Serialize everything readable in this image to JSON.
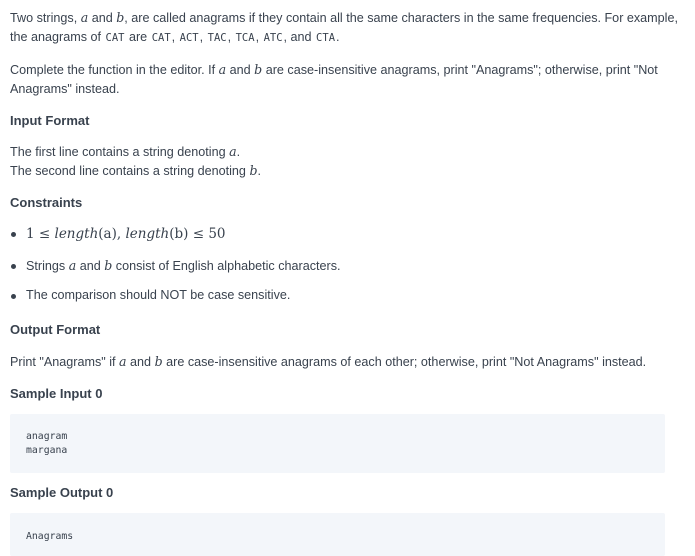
{
  "intro": {
    "t1": "Two strings, ",
    "a": "a",
    "t2": " and ",
    "b": "b",
    "t3": ", are called anagrams if they contain all the same characters in the same frequencies. For example, the anagrams of ",
    "code1": "CAT",
    "t4": " are ",
    "code2": "CAT",
    "sep1": ", ",
    "code3": "ACT",
    "sep2": ", ",
    "code4": "TAC",
    "sep3": ", ",
    "code5": "TCA",
    "sep4": ", ",
    "code6": "ATC",
    "t5": ", and ",
    "code7": "CTA",
    "t6": "."
  },
  "task": {
    "t1": "Complete the function in the editor. If ",
    "a": "a",
    "t2": " and ",
    "b": "b",
    "t3": " are case-insensitive anagrams, print \"Anagrams\"; otherwise, print \"Not Anagrams\" instead."
  },
  "input_format": {
    "heading": "Input Format",
    "line1_text": "The first line contains a string denoting ",
    "line1_var": "a",
    "line1_end": ".",
    "line2_text": "The second line contains a string denoting ",
    "line2_var": "b",
    "line2_end": "."
  },
  "constraints": {
    "heading": "Constraints",
    "c1_one": "1",
    "c1_le1": " ≤ ",
    "c1_lena": "length",
    "c1_pa": "(a)",
    "c1_comma": ", ",
    "c1_lenb": "length",
    "c1_pb": "(b)",
    "c1_le2": " ≤ ",
    "c1_fifty": "50",
    "c2_t1": "Strings ",
    "c2_a": "a",
    "c2_t2": " and ",
    "c2_b": "b",
    "c2_t3": " consist of English alphabetic characters.",
    "c3": "The comparison should NOT be case sensitive."
  },
  "output_format": {
    "heading": "Output Format",
    "t1": "Print \"Anagrams\" if ",
    "a": "a",
    "t2": " and ",
    "b": "b",
    "t3": " are case-insensitive anagrams of each other; otherwise, print \"Not Anagrams\" instead."
  },
  "sample_input": {
    "heading": "Sample Input 0",
    "line1": "anagram",
    "line2": "margana"
  },
  "sample_output": {
    "heading": "Sample Output 0",
    "line1": "Anagrams"
  }
}
